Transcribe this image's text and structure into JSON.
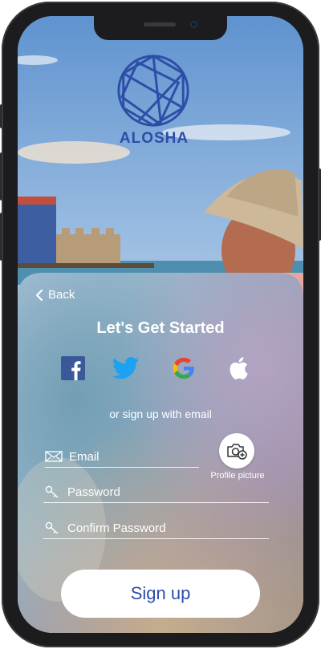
{
  "brand": {
    "name": "ALOSHA"
  },
  "nav": {
    "back_label": "Back"
  },
  "title": "Let's Get Started",
  "social": [
    {
      "name": "facebook",
      "icon": "facebook-icon",
      "color": "#3b5998"
    },
    {
      "name": "twitter",
      "icon": "twitter-icon",
      "color": "#1da1f2"
    },
    {
      "name": "google",
      "icon": "google-icon",
      "color": "#4285f4"
    },
    {
      "name": "apple",
      "icon": "apple-icon",
      "color": "#ffffff"
    }
  ],
  "divider_text": "or sign up with email",
  "form": {
    "email_label": "Email",
    "password_label": "Password",
    "confirm_password_label": "Confirm Password",
    "profile_picture_label": "Profile picture"
  },
  "primary_action": {
    "label": "Sign up"
  },
  "colors": {
    "accent": "#2d4ea7",
    "facebook": "#3b5998",
    "twitter": "#1da1f2"
  }
}
